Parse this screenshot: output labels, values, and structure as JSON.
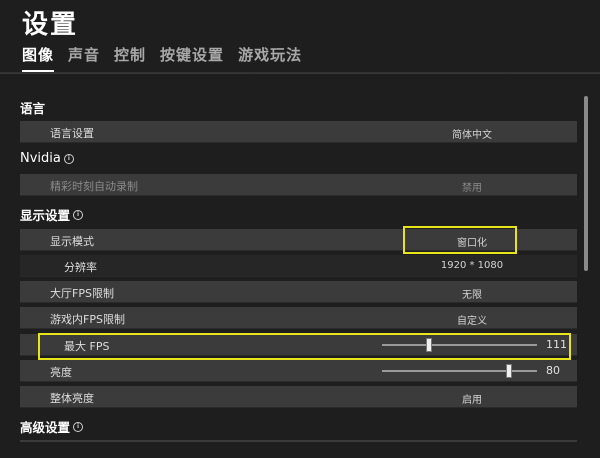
{
  "header": {
    "title": "设置"
  },
  "tabs": [
    {
      "label": "图像",
      "active": true
    },
    {
      "label": "声音",
      "active": false
    },
    {
      "label": "控制",
      "active": false
    },
    {
      "label": "按键设置",
      "active": false
    },
    {
      "label": "游戏玩法",
      "active": false
    }
  ],
  "sections": {
    "language": {
      "title": "语言",
      "rows": [
        {
          "label": "语言设置",
          "value": "简体中文"
        }
      ]
    },
    "nvidia": {
      "title": "Nvidia",
      "info_icon": "info-icon",
      "rows": [
        {
          "label": "精彩时刻自动录制",
          "value": "禁用"
        }
      ]
    },
    "display": {
      "title": "显示设置",
      "info_icon": "info-icon",
      "rows": [
        {
          "label": "显示模式",
          "value": "窗口化"
        },
        {
          "label": "分辨率",
          "value": "1920 * 1080"
        },
        {
          "label": "大厅FPS限制",
          "value": "无限"
        },
        {
          "label": "游戏内FPS限制",
          "value": "自定义"
        },
        {
          "label": "最大 FPS",
          "value": "111",
          "slider_fraction": 0.3
        },
        {
          "label": "亮度",
          "value": "80",
          "slider_fraction": 0.82
        },
        {
          "label": "整体亮度",
          "value": "启用"
        }
      ]
    },
    "advanced": {
      "title": "高级设置",
      "info_icon": "info-icon"
    }
  },
  "colors": {
    "highlight": "#e8e41a",
    "row_bg": "#3b3b3b",
    "page_bg": "#1e1e1e"
  }
}
